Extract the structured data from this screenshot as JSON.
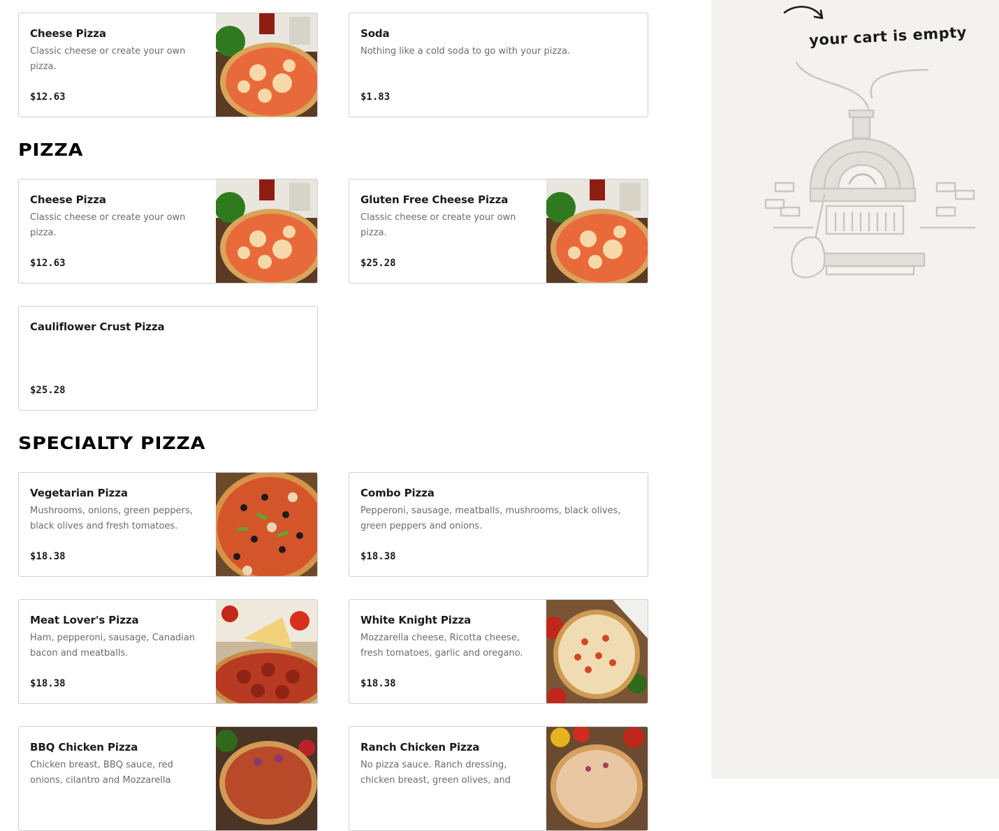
{
  "sections": [
    {
      "title": ""
    },
    {
      "title": "PIZZA"
    },
    {
      "title": "SPECIALTY PIZZA"
    }
  ],
  "items": [
    {
      "name": "Cheese Pizza",
      "description": "Classic cheese or create your own pizza.",
      "price": "$12.63",
      "image": "cheese-pizza"
    },
    {
      "name": "Soda",
      "description": "Nothing like a cold soda to go with your pizza.",
      "price": "$1.83",
      "image": ""
    },
    {
      "name": "Cheese Pizza",
      "description": "Classic cheese or create your own pizza.",
      "price": "$12.63",
      "image": "cheese-pizza"
    },
    {
      "name": "Gluten Free Cheese Pizza",
      "description": "Classic cheese or create your own pizza.",
      "price": "$25.28",
      "image": "cheese-pizza"
    },
    {
      "name": "Cauliflower Crust Pizza",
      "description": "",
      "price": "$25.28",
      "image": ""
    },
    {
      "name": "Vegetarian Pizza",
      "description": "Mushrooms, onions, green peppers, black olives and fresh tomatoes.",
      "price": "$18.38",
      "image": "vegetarian-pizza"
    },
    {
      "name": "Combo Pizza",
      "description": "Pepperoni, sausage, meatballs, mushrooms, black olives, green peppers and onions.",
      "price": "$18.38",
      "image": ""
    },
    {
      "name": "Meat Lover's Pizza",
      "description": "Ham, pepperoni, sausage, Canadian bacon and meatballs.",
      "price": "$18.38",
      "image": "meat-lovers-pizza"
    },
    {
      "name": "White Knight Pizza",
      "description": "Mozzarella cheese, Ricotta cheese, fresh tomatoes, garlic and oregano.",
      "price": "$18.38",
      "image": "white-knight-pizza"
    },
    {
      "name": "BBQ Chicken Pizza",
      "description": "Chicken breast, BBQ sauce, red onions, cilantro and Mozzarella cheese.",
      "price": "",
      "image": "bbq-chicken-pizza"
    },
    {
      "name": "Ranch Chicken Pizza",
      "description": "No pizza sauce. Ranch dressing, chicken breast, green olives, and",
      "price": "",
      "image": "ranch-chicken-pizza"
    }
  ],
  "cart": {
    "empty_text": "your cart is empty",
    "illustration": "pizza-oven-illustration",
    "arrow_icon": "curved-arrow-icon"
  },
  "colors": {
    "cart_background": "#f3f2ef",
    "card_border": "#cfcfcf",
    "description_text": "#6b6b6b"
  }
}
